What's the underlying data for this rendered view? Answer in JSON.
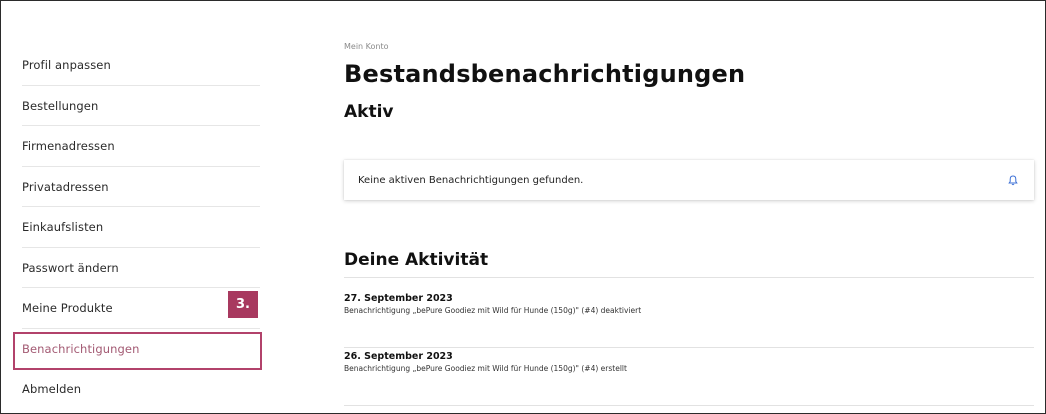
{
  "sidebar": {
    "items": [
      {
        "label": "Profil anpassen"
      },
      {
        "label": "Bestellungen"
      },
      {
        "label": "Firmenadressen"
      },
      {
        "label": "Privatadressen"
      },
      {
        "label": "Einkaufslisten"
      },
      {
        "label": "Passwort ändern"
      },
      {
        "label": "Meine Produkte"
      },
      {
        "label": "Benachrichtigungen",
        "active": true
      },
      {
        "label": "Abmelden"
      }
    ],
    "step_badge": "3."
  },
  "main": {
    "breadcrumb": "Mein Konto",
    "title": "Bestandsbenachrichtigungen",
    "active_section_title": "Aktiv",
    "active_notice": "Keine aktiven Benachrichtigungen gefunden.",
    "activity_title": "Deine Aktivität",
    "activities": [
      {
        "date": "27. September 2023",
        "description": "Benachrichtigung „bePure Goodiez mit Wild für Hunde (150g)\" (#4) deaktiviert"
      },
      {
        "date": "26. September 2023",
        "description": "Benachrichtigung „bePure Goodiez mit Wild für Hunde (150g)\" (#4) erstellt"
      }
    ]
  },
  "colors": {
    "highlight": "#b2426b",
    "badge": "#a8395f",
    "active_link": "#a35a73",
    "bell_icon": "#3b6fd6"
  },
  "icons": {
    "notice": "bell-icon"
  }
}
